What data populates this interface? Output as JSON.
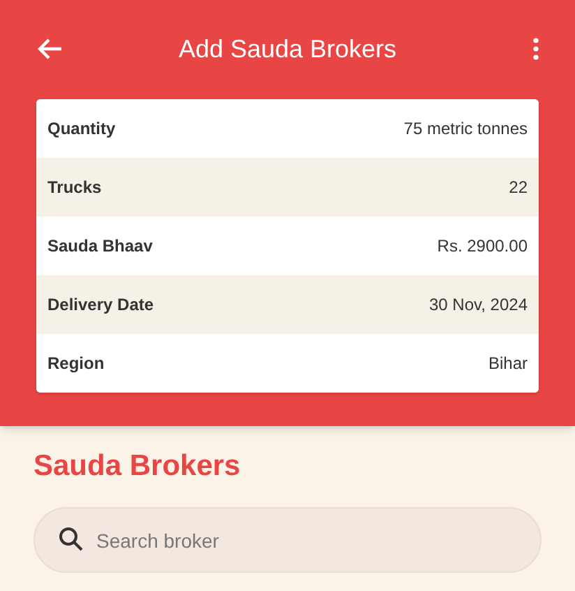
{
  "app_bar": {
    "title": "Add Sauda Brokers"
  },
  "details": [
    {
      "label": "Quantity",
      "value": "75 metric tonnes"
    },
    {
      "label": "Trucks",
      "value": "22"
    },
    {
      "label": "Sauda Bhaav",
      "value": "Rs. 2900.00"
    },
    {
      "label": "Delivery Date",
      "value": "30 Nov, 2024"
    },
    {
      "label": "Region",
      "value": "Bihar"
    }
  ],
  "section_title": "Sauda Brokers",
  "search": {
    "placeholder": "Search broker"
  }
}
